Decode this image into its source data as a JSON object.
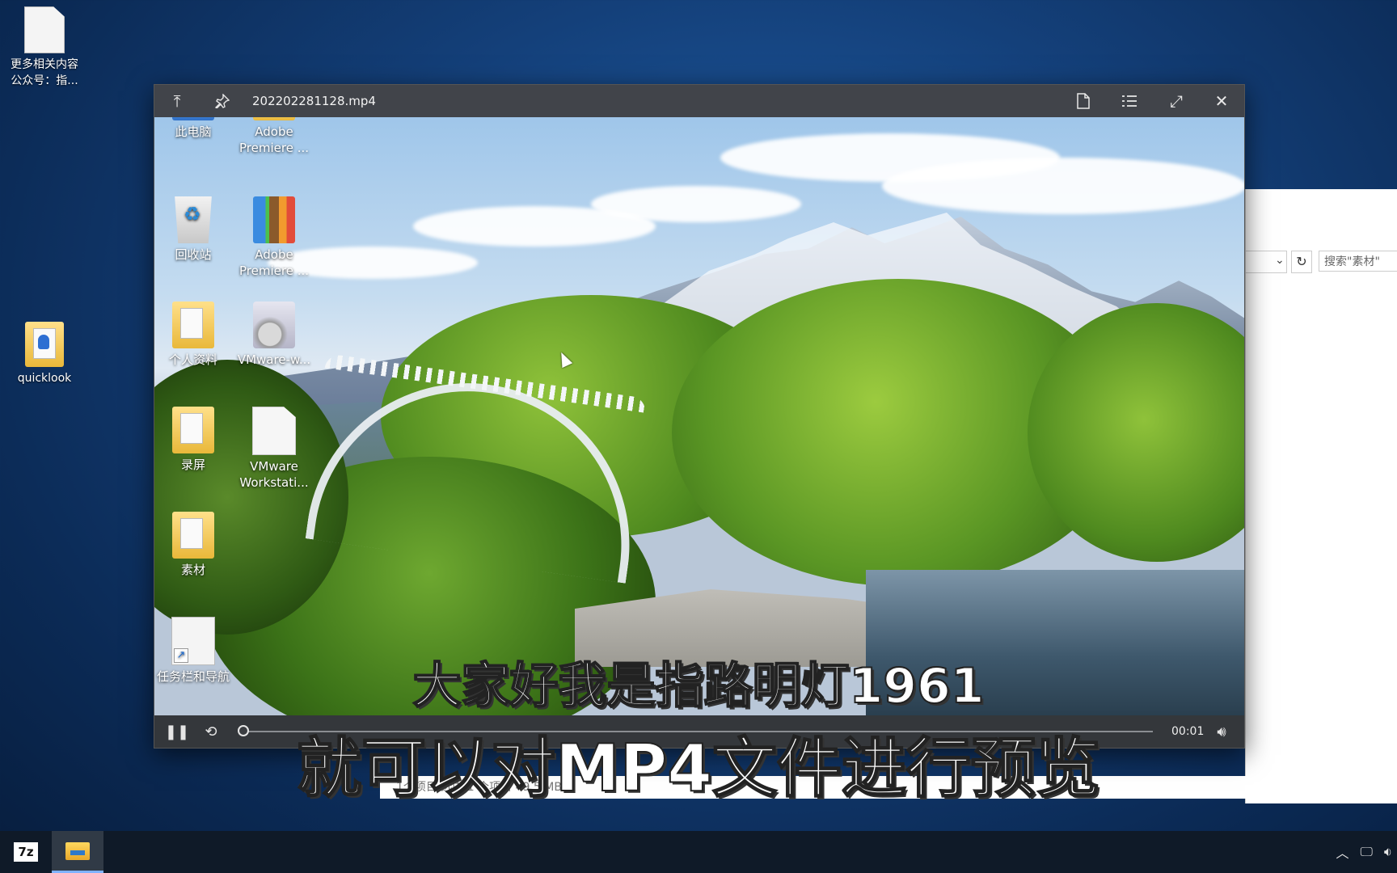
{
  "desktop": {
    "icons": [
      {
        "label": "更多相关内容\n公众号：指..."
      },
      {
        "label": "quicklook"
      }
    ]
  },
  "viewer": {
    "title": "202202281128.mp4",
    "buttons": {
      "pin_top": "⤒",
      "pin": "📌",
      "open_with": "open-file-icon",
      "properties": "list-icon",
      "fullscreen": "⤢",
      "close": "✕"
    },
    "video_icons": [
      {
        "label": "此电脑"
      },
      {
        "label": "Adobe\nPremiere ..."
      },
      {
        "label": "回收站"
      },
      {
        "label": "Adobe\nPremiere ..."
      },
      {
        "label": "个人资料"
      },
      {
        "label": "VMware-w..."
      },
      {
        "label": "录屏"
      },
      {
        "label": "VMware\nWorkstati..."
      },
      {
        "label": "素材"
      },
      {
        "label": "任务栏和导航"
      }
    ],
    "controls": {
      "time": "00:01",
      "progress": 0.0
    }
  },
  "explorer": {
    "search_placeholder": "搜索\"素材\"",
    "status": "1个项目   选中 1 个项目 49.5 MB"
  },
  "subtitles": {
    "line1": "大家好我是指路明灯1961",
    "line2": "就可以对MP4文件进行预览"
  },
  "taskbar": {
    "apps": [
      "7z",
      "file-explorer"
    ]
  }
}
